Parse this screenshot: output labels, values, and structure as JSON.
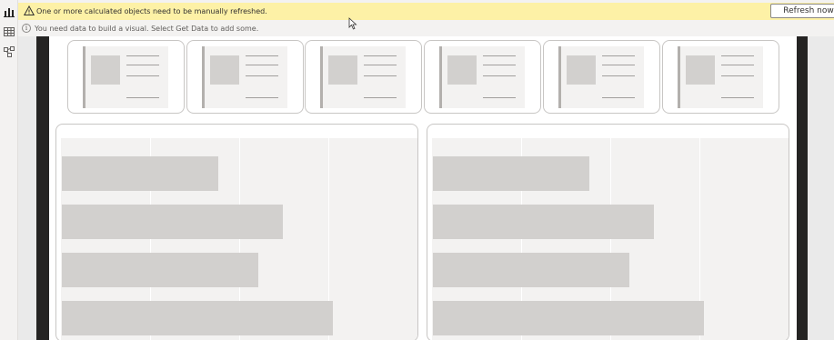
{
  "warning_banner": {
    "message": "One or more calculated objects need to be manually refreshed.",
    "button_label": "Refresh now",
    "icon": "warning-icon",
    "background": "#fdf1a6"
  },
  "info_banner": {
    "message": "You need data to build a visual. Select Get Data to add some.",
    "icon": "info-icon"
  },
  "left_rail": {
    "items": [
      {
        "icon": "report-view-icon"
      },
      {
        "icon": "table-view-icon"
      },
      {
        "icon": "model-view-icon"
      }
    ]
  },
  "cards": [
    {
      "type": "card-placeholder"
    },
    {
      "type": "card-placeholder"
    },
    {
      "type": "card-placeholder"
    },
    {
      "type": "card-placeholder"
    },
    {
      "type": "card-placeholder"
    },
    {
      "type": "card-placeholder"
    }
  ],
  "charts": [
    {
      "type": "bar-placeholder",
      "bar_fractions": [
        0.44,
        0.62,
        0.55,
        0.76
      ]
    },
    {
      "type": "bar-placeholder",
      "bar_fractions": [
        0.44,
        0.62,
        0.55,
        0.76
      ]
    }
  ]
}
